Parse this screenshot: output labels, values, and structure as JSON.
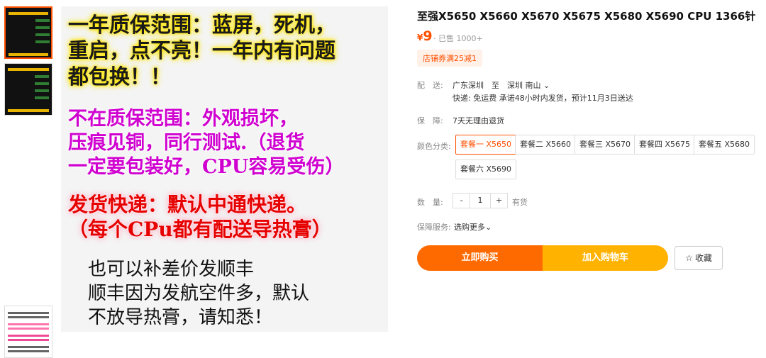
{
  "product": {
    "title": "至强X5650 X5660 X5670 X5675 X5680 X5690 CPU 1366针",
    "price_currency": "¥",
    "price_value": "9",
    "sold": "· 已售 1000+",
    "coupon": "店铺券满25减1"
  },
  "gallery": {
    "text1": "一年质保范围：蓝屏，死机，\n重启，点不亮！一年内有问题\n都包换！！",
    "text2": "不在质保范围：外观损坏，\n压痕见铜，同行测试.（退货\n一定要包装好，CPU容易受伤）",
    "text3": "发货快递：默认中通快递。\n（每个CPu都有配送导热膏）",
    "text4": "也可以补差价发顺丰\n顺丰因为发航空件多，默认\n不放导热膏，请知悉！"
  },
  "shipping": {
    "label": "配　送:",
    "route": "广东深圳　至　深圳 南山",
    "detail": "快递: 免运费  承诺48小时内发货，预计11月3日送达"
  },
  "guarantee": {
    "label": "保　障:",
    "value": "7天无理由退货"
  },
  "color": {
    "label": "颜色分类:",
    "options": [
      "套餐一 X5650",
      "套餐二 X5660",
      "套餐三 X5670",
      "套餐四 X5675",
      "套餐五 X5680",
      "套餐六 X5690"
    ]
  },
  "quantity": {
    "label": "数　量:",
    "minus": "-",
    "value": "1",
    "plus": "+",
    "stock": "有货"
  },
  "service": {
    "label": "保障服务:",
    "value": "选购更多"
  },
  "actions": {
    "buy": "立即购买",
    "cart": "加入购物车",
    "fav": "收藏"
  },
  "colors": {
    "accent": "#ff5000",
    "buy": "#ff6a00",
    "cart": "#ffb300"
  }
}
